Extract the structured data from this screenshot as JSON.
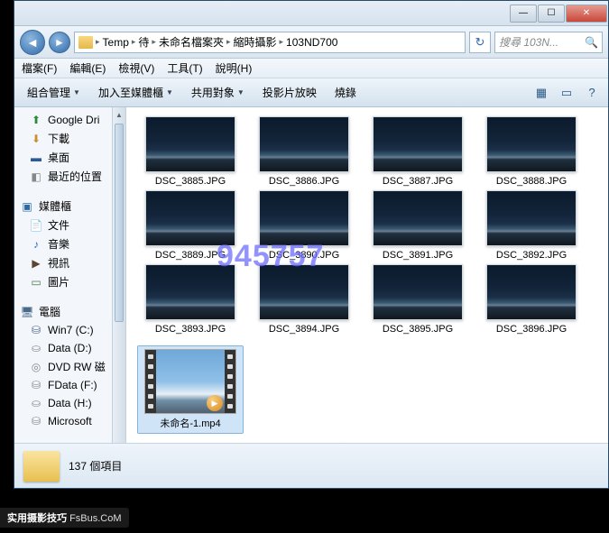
{
  "titlebar": {
    "min": "—",
    "max": "☐",
    "close": "✕"
  },
  "nav": {
    "back": "◄",
    "fwd": "►",
    "path": [
      "Temp",
      "待",
      "未命名檔案夾",
      "縮時攝影",
      "103ND700"
    ],
    "refresh": "↻",
    "search_placeholder": "搜尋 103N...",
    "search_icon": "🔍"
  },
  "menubar": [
    "檔案(F)",
    "編輯(E)",
    "檢視(V)",
    "工具(T)",
    "說明(H)"
  ],
  "toolbar": {
    "items": [
      "組合管理",
      "加入至媒體櫃",
      "共用對象",
      "投影片放映",
      "燒錄"
    ],
    "icons": [
      "▦",
      "▭",
      "?"
    ]
  },
  "sidebar": {
    "fav": [
      {
        "icon": "⬆",
        "label": "Google Dri",
        "color": "#2a8a3a"
      },
      {
        "icon": "⬇",
        "label": "下載",
        "color": "#c89030"
      },
      {
        "icon": "▬",
        "label": "桌面",
        "color": "#2a5a9a"
      },
      {
        "icon": "◧",
        "label": "最近的位置",
        "color": "#888"
      }
    ],
    "lib_title": "媒體櫃",
    "lib": [
      {
        "icon": "📄",
        "label": "文件",
        "color": "#888"
      },
      {
        "icon": "♪",
        "label": "音樂",
        "color": "#2a6ac0"
      },
      {
        "icon": "▶",
        "label": "視訊",
        "color": "#5a4630"
      },
      {
        "icon": "▭",
        "label": "圖片",
        "color": "#4a7a4a"
      }
    ],
    "comp_title": "電腦",
    "comp": [
      {
        "icon": "⛁",
        "label": "Win7 (C:)",
        "color": "#4a6a8a"
      },
      {
        "icon": "⛀",
        "label": "Data (D:)",
        "color": "#888"
      },
      {
        "icon": "◎",
        "label": "DVD RW 磁",
        "color": "#888"
      },
      {
        "icon": "⛁",
        "label": "FData (F:)",
        "color": "#888"
      },
      {
        "icon": "⛀",
        "label": "Data (H:)",
        "color": "#888"
      },
      {
        "icon": "⛁",
        "label": "Microsoft",
        "color": "#888"
      }
    ]
  },
  "files": [
    "DSC_3885.JPG",
    "DSC_3886.JPG",
    "DSC_3887.JPG",
    "DSC_3888.JPG",
    "DSC_3889.JPG",
    "DSC_3890.JPG",
    "DSC_3891.JPG",
    "DSC_3892.JPG",
    "DSC_3893.JPG",
    "DSC_3894.JPG",
    "DSC_3895.JPG",
    "DSC_3896.JPG"
  ],
  "video_file": "未命名-1.mp4",
  "status": {
    "count": "137 個項目"
  },
  "watermark": "945757",
  "corner": {
    "label": "实用摄影技巧",
    "domain": "FsBus.CoM"
  }
}
